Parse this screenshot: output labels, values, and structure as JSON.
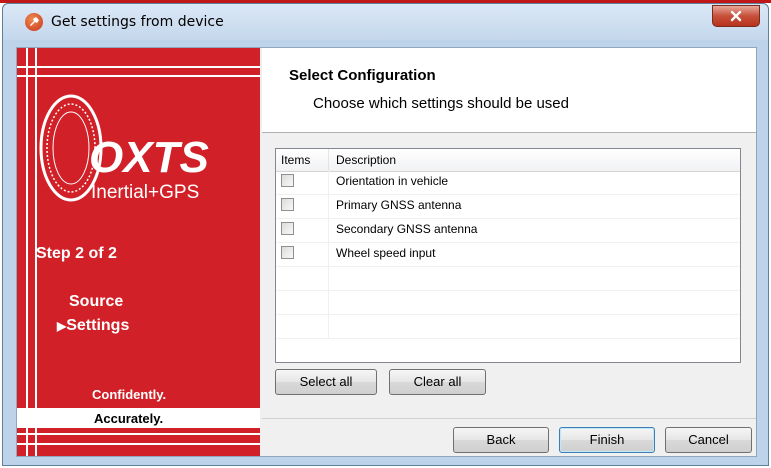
{
  "window": {
    "title": "Get settings from device",
    "close_label": "x"
  },
  "sidebar": {
    "logo_brand": "OXTS",
    "logo_sub": "Inertial+GPS",
    "step_text": "Step 2 of 2",
    "nav_items": [
      {
        "label": "Source",
        "current": false
      },
      {
        "label": "Settings",
        "current": true,
        "marker": "▶"
      }
    ],
    "tagline_1": "Confidently.",
    "tagline_2": "Accurately."
  },
  "header": {
    "title": "Select Configuration",
    "subtitle": "Choose which settings should be used"
  },
  "list": {
    "columns": [
      "Items",
      "Description"
    ],
    "rows": [
      {
        "checked": false,
        "description": "Orientation in vehicle"
      },
      {
        "checked": false,
        "description": "Primary GNSS antenna"
      },
      {
        "checked": false,
        "description": "Secondary GNSS antenna"
      },
      {
        "checked": false,
        "description": "Wheel speed input"
      }
    ]
  },
  "actions": {
    "select_all": "Select all",
    "clear_all": "Clear all"
  },
  "footer": {
    "back": "Back",
    "finish": "Finish",
    "cancel": "Cancel"
  },
  "colors": {
    "brand_red": "#d12027",
    "titlebar": "#c4d7ec"
  }
}
